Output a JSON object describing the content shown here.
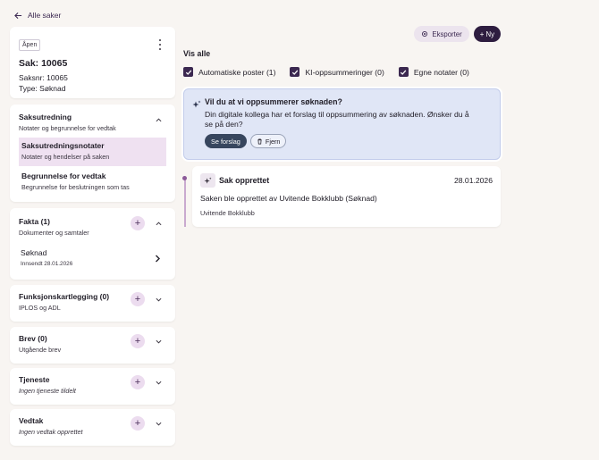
{
  "nav": {
    "back_label": "Alle saker"
  },
  "case": {
    "status": "Åpen",
    "title": "Sak: 10065",
    "saksnr": "Saksnr: 10065",
    "type": "Type: Søknad"
  },
  "sections": {
    "saksutredning": {
      "title": "Saksutredning",
      "subtitle": "Notater og begrunnelse for vedtak",
      "items": [
        {
          "title": "Saksutredningsnotater",
          "subtitle": "Notater og hendelser på saken"
        },
        {
          "title": "Begrunnelse for vedtak",
          "subtitle": "Begrunnelse for beslutningen som tas"
        }
      ]
    },
    "fakta": {
      "title": "Fakta (1)",
      "subtitle": "Dokumenter og samtaler",
      "doc": {
        "title": "Søknad",
        "date": "Innsendt 28.01.2026"
      }
    },
    "funksjon": {
      "title": "Funksjonskartlegging (0)",
      "subtitle": "IPLOS og ADL"
    },
    "brev": {
      "title": "Brev (0)",
      "subtitle": "Utgående brev"
    },
    "tjeneste": {
      "title": "Tjeneste",
      "subtitle": "Ingen tjeneste tildelt"
    },
    "vedtak": {
      "title": "Vedtak",
      "subtitle": "Ingen vedtak opprettet"
    }
  },
  "toolbar": {
    "export_label": "Eksporter",
    "new_label": "+ Ny"
  },
  "filters": {
    "heading": "Vis alle",
    "items": [
      "Automatiske poster (1)",
      "KI-oppsummeringer (0)",
      "Egne notater (0)"
    ]
  },
  "ai_suggestion": {
    "title": "Vil du at vi oppsummerer søknaden?",
    "text": "Din digitale kollega har et forslag til oppsummering av søknaden. Ønsker du å se på den?",
    "primary_label": "Se forslag",
    "secondary_label": "Fjern"
  },
  "event": {
    "title": "Sak opprettet",
    "date": "28.01.2026",
    "description": "Saken ble opprettet av Uvitende Bokklubb (Søknad)",
    "actor": "Uvitende Bokklubb"
  },
  "colors": {
    "background": "#f8f5f2",
    "accent_dark": "#2e1d40",
    "accent_soft": "#efe1f1",
    "ai_background": "#e0e6f6"
  },
  "icons": [
    "arrow-left-icon",
    "kebab-icon",
    "chevron-up-icon",
    "chevron-down-icon",
    "plus-icon",
    "chevron-right-icon",
    "gear-icon",
    "check-icon",
    "sparkle-icon",
    "trash-icon"
  ]
}
